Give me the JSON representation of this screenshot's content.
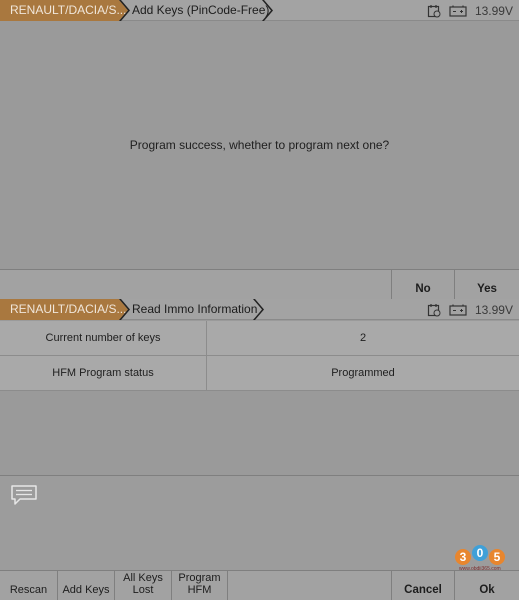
{
  "screen1": {
    "breadcrumb_brand": "RENAULT/DACIA/S...",
    "page_title": "Add Keys (PinCode-Free)",
    "battery_voltage": "13.99V",
    "message": "Program success, whether to program next one?",
    "buttons": {
      "no": "No",
      "yes": "Yes"
    }
  },
  "screen2": {
    "breadcrumb_brand": "RENAULT/DACIA/S...",
    "page_title": "Read Immo Information",
    "battery_voltage": "13.99V",
    "rows": [
      {
        "label": "Current number of keys",
        "value": "2"
      },
      {
        "label": "HFM Program status",
        "value": "Programmed"
      }
    ],
    "buttons": {
      "rescan": "Rescan",
      "add_keys": "Add Keys",
      "all_keys_lost_1": "All Keys",
      "all_keys_lost_2": "Lost",
      "program_hfm_1": "Program",
      "program_hfm_2": "HFM",
      "cancel": "Cancel",
      "ok": "Ok"
    }
  },
  "watermark": {
    "digits": [
      "3",
      "0",
      "5"
    ],
    "url": "www.obdii365.com"
  },
  "colors": {
    "brand_tab": "#a9783f",
    "background": "#9a9a9a",
    "bar": "#a2a2a2"
  }
}
